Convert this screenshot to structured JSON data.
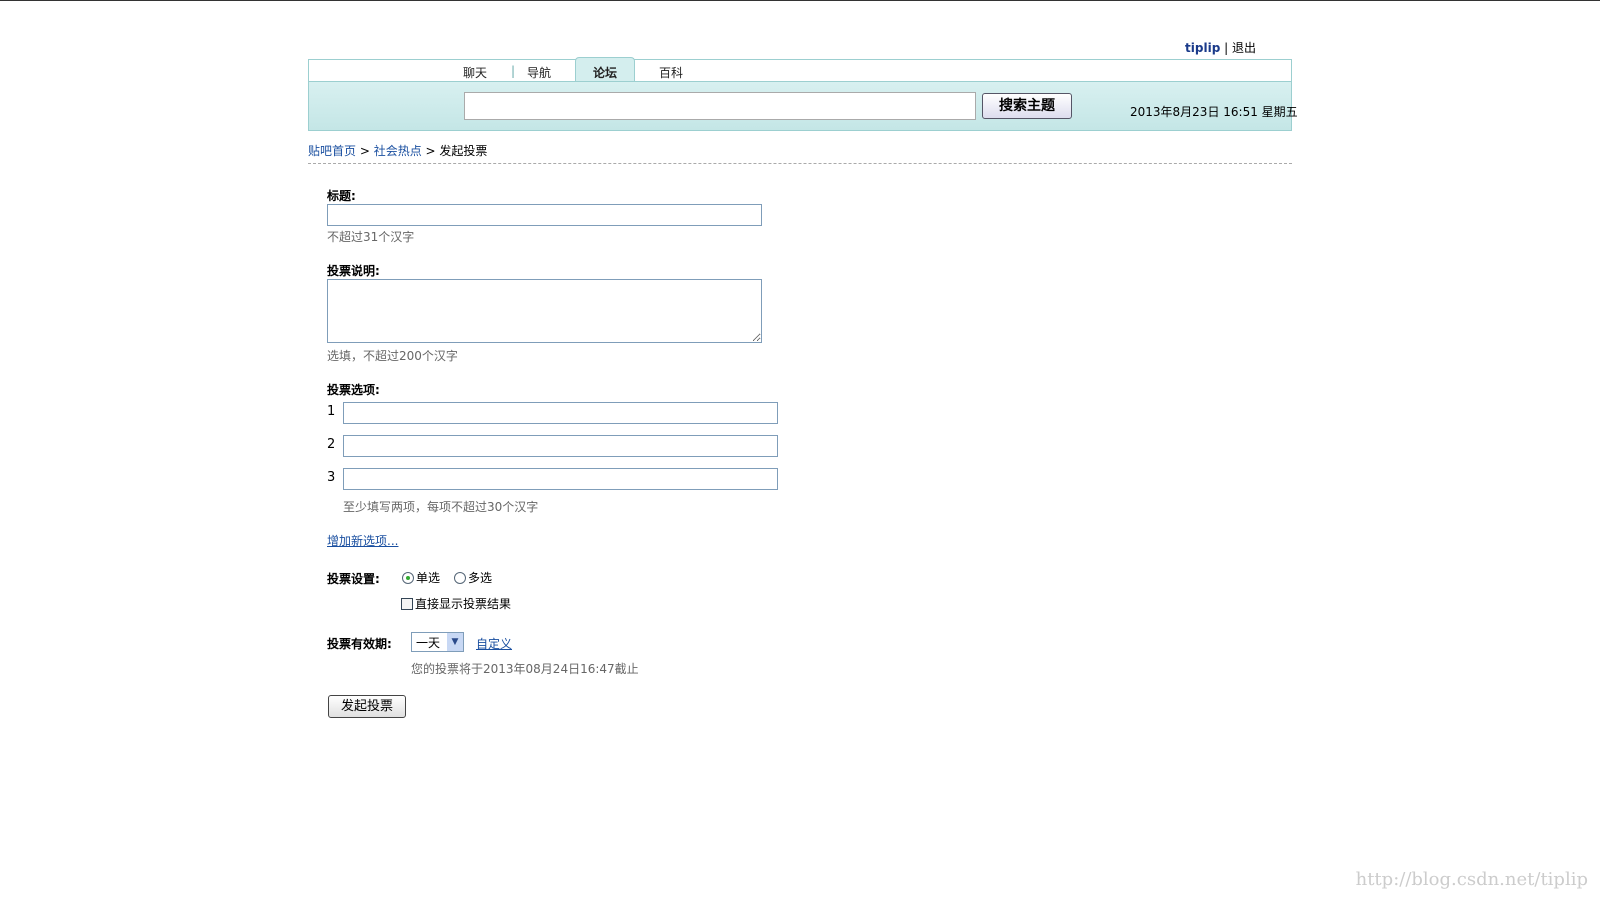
{
  "user": {
    "name": "tiplip",
    "logout": "退出"
  },
  "nav": {
    "tabs": [
      "聊天",
      "导航",
      "论坛",
      "百科"
    ],
    "active": 2
  },
  "search": {
    "value": "",
    "button": "搜索主题"
  },
  "datetime": "2013年8月23日 16:51 星期五",
  "breadcrumb": {
    "home": "贴吧首页",
    "category": "社会热点",
    "current": "发起投票"
  },
  "form": {
    "title_label": "标题:",
    "title_hint": "不超过31个汉字",
    "desc_label": "投票说明:",
    "desc_hint": "选填，不超过200个汉字",
    "options_label": "投票选项:",
    "options": [
      "1",
      "2",
      "3"
    ],
    "options_hint": "至少填写两项，每项不超过30个汉字",
    "add_option": "增加新选项...",
    "settings_label": "投票设置:",
    "single": "单选",
    "multi": "多选",
    "show_result": "直接显示投票结果",
    "validity_label": "投票有效期:",
    "validity_value": "一天",
    "custom": "自定义",
    "deadline": "您的投票将于2013年08月24日16:47截止",
    "submit": "发起投票"
  },
  "watermark": "http://blog.csdn.net/tiplip"
}
